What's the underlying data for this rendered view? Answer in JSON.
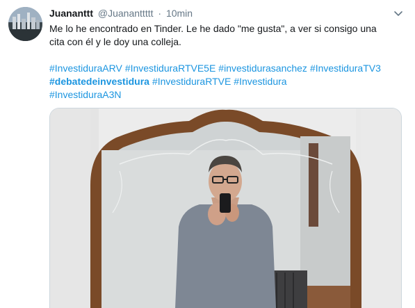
{
  "tweet": {
    "author_name": "Juananttt",
    "handle": "@Juananttttt",
    "separator": "·",
    "time": "10min",
    "text_line1": "Me lo he encontrado en Tinder. Le he dado \"me gusta\", a ver si consigo una",
    "text_line2": "cita con él y le doy una colleja.",
    "hashtags": [
      "#InvestiduraARV",
      "#InvestiduraRTVE5E",
      "#investidurasanchez",
      "#InvestiduraTV3",
      "#debatedeinvestidura",
      "#InvestiduraRTVE",
      "#Investidura",
      "#InvestiduraA3N"
    ],
    "caret_icon": "chevron-down-icon",
    "link_color": "#1b95e0"
  }
}
